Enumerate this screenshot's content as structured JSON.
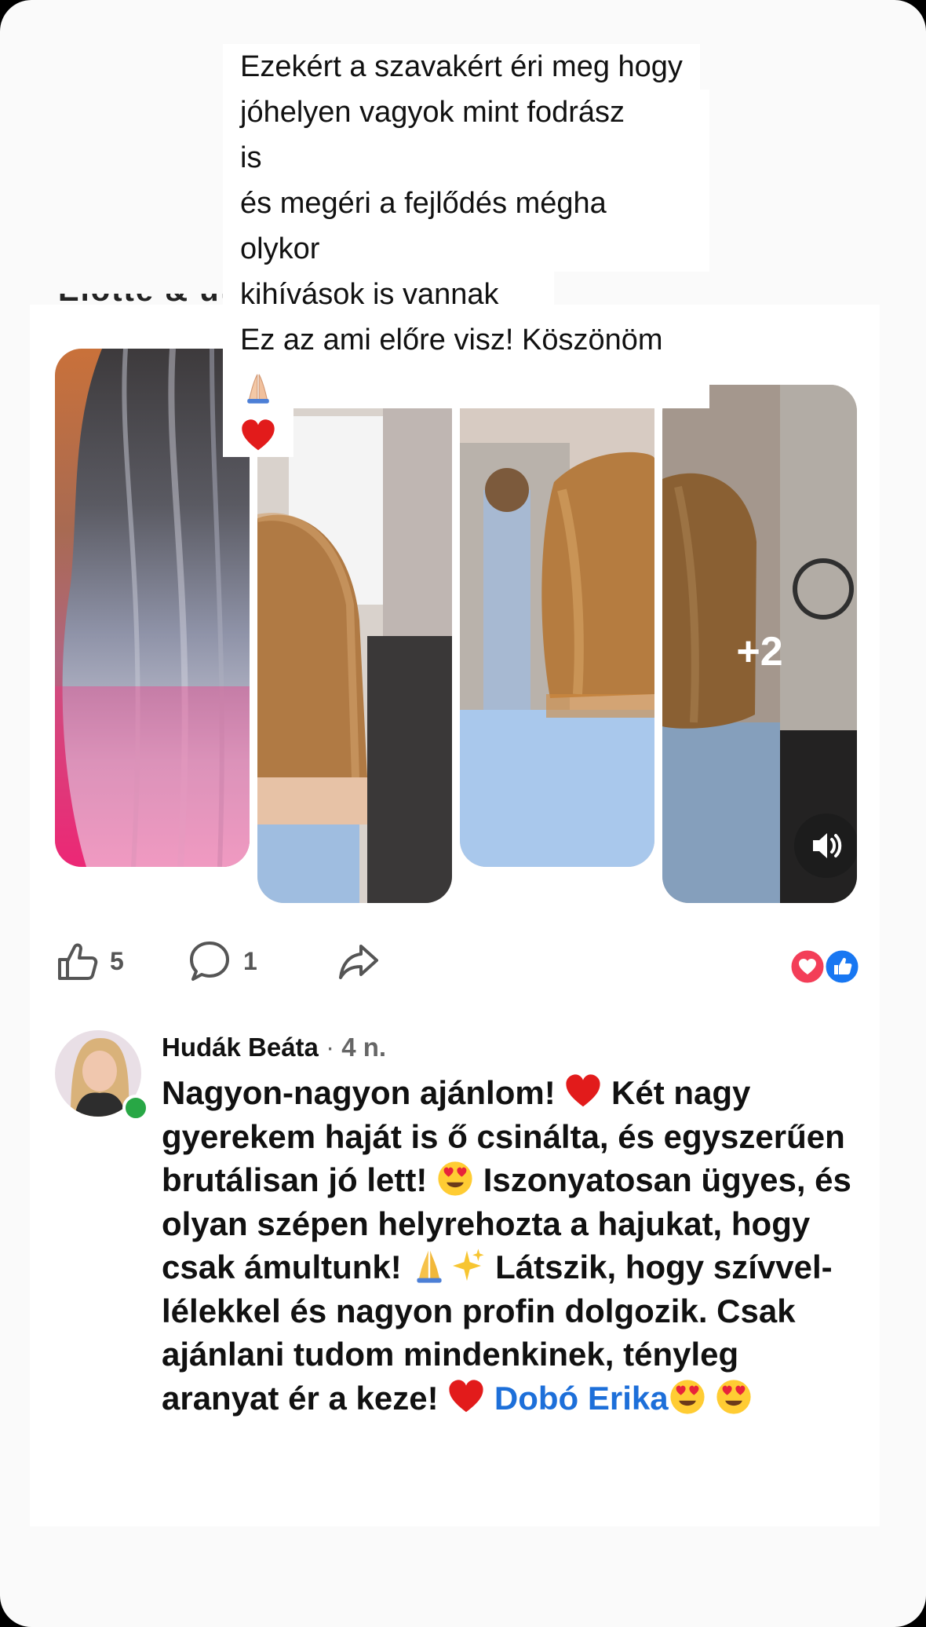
{
  "story_caption": {
    "lines": [
      "Ezekért a szavakért éri meg hogy",
      "jóhelyen vagyok mint fodrász is",
      "és megéri a fejlődés mégha olykor",
      "kihívások is vannak",
      "Ez az ami előre visz! Köszönöm"
    ],
    "trailing_emoji": [
      "folded-hands",
      "red-heart"
    ]
  },
  "post": {
    "more_photos_label": "+2",
    "photo_count_visible": 4
  },
  "actions": {
    "like_count": "5",
    "comment_count": "1"
  },
  "reactions": [
    "love",
    "like"
  ],
  "comment": {
    "author": "Hudák Beáta",
    "separator": "·",
    "time": "4 n.",
    "text_parts": [
      "Nagyon-nagyon ajánlom! ",
      " Két nagy gyerekem haját is ő csinálta, és egyszerűen brutálisan jó lett! ",
      " Iszonyatosan ügyes, és olyan szépen helyrehozta a hajukat, hogy csak ámultunk! ",
      " Látszik, hogy szívvel-lélekkel és nagyon profin dolgozik. Csak ajánlani tudom mindenkinek, tényleg aranyat ér a keze! ",
      " "
    ],
    "mention": "Dobó Erika",
    "author_online": true
  },
  "colors": {
    "mention": "#1d6fd9",
    "online": "#28a745",
    "love": "#f33e58",
    "like": "#1877f2"
  }
}
